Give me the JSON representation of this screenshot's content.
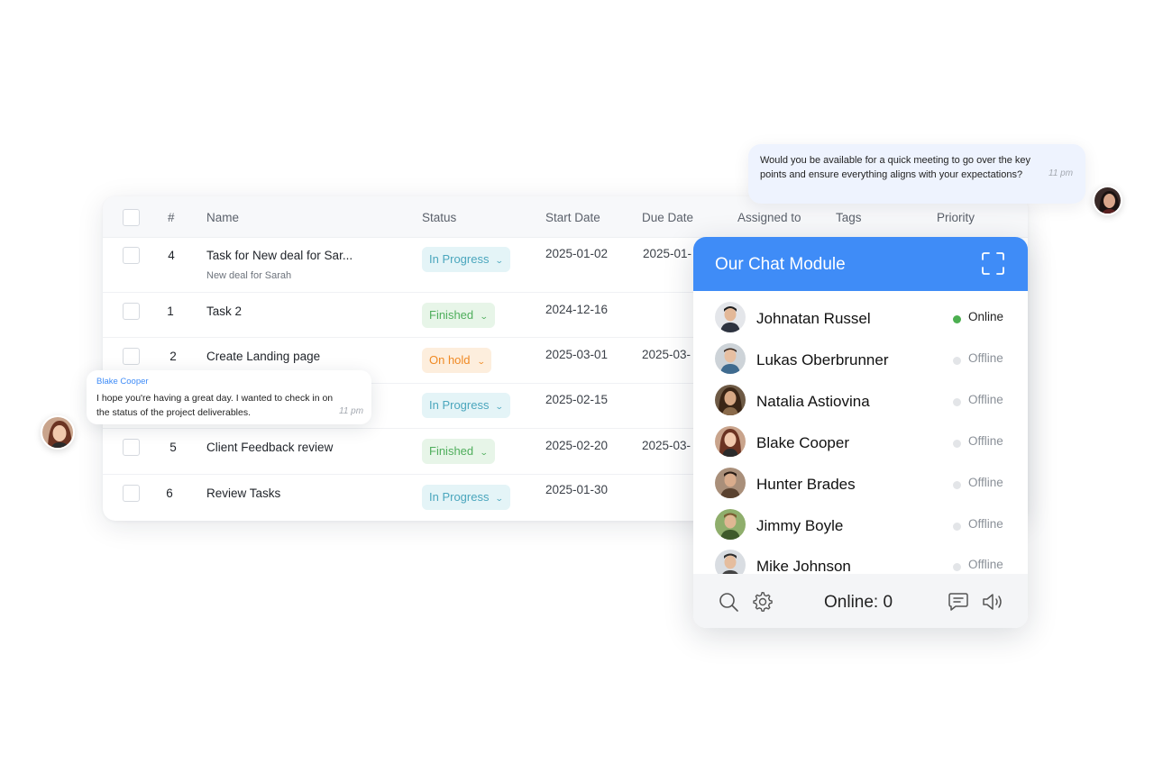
{
  "table": {
    "headers": [
      "#",
      "Name",
      "Status",
      "Start Date",
      "Due Date",
      "Assigned to",
      "Tags",
      "Priority"
    ],
    "rows": [
      {
        "num": "4",
        "name": "Task for New deal for Sar...",
        "subtitle": "New deal for Sarah",
        "status": "In Progress",
        "start": "2025-01-02",
        "due": "2025-01-"
      },
      {
        "num": "1",
        "name": "Task 2",
        "subtitle": "",
        "status": "Finished",
        "start": "2024-12-16",
        "due": ""
      },
      {
        "num": "2",
        "name": "Create Landing page",
        "subtitle": "",
        "status": "On hold",
        "start": "2025-03-01",
        "due": "2025-03-"
      },
      {
        "num": "",
        "name": "",
        "subtitle": "",
        "status": "In Progress",
        "start": "2025-02-15",
        "due": ""
      },
      {
        "num": "5",
        "name": "Client Feedback review",
        "subtitle": "",
        "status": "Finished",
        "start": "2025-02-20",
        "due": "2025-03-"
      },
      {
        "num": "6",
        "name": "Review Tasks",
        "subtitle": "",
        "status": "In Progress",
        "start": "2025-01-30",
        "due": ""
      }
    ]
  },
  "chat": {
    "title": "Our Chat Module",
    "online_label": "Online: 0",
    "contacts": [
      {
        "name": "Johnatan Russel",
        "status": "Online",
        "status_color": "#4caf50"
      },
      {
        "name": "Lukas Oberbrunner",
        "status": "Offline",
        "status_color": "#e3e5e8"
      },
      {
        "name": "Natalia Astiovina",
        "status": "Offline",
        "status_color": "#e3e5e8"
      },
      {
        "name": "Blake Cooper",
        "status": "Offline",
        "status_color": "#e3e5e8"
      },
      {
        "name": "Hunter Brades",
        "status": "Offline",
        "status_color": "#e3e5e8"
      },
      {
        "name": "Jimmy Boyle",
        "status": "Offline",
        "status_color": "#e3e5e8"
      },
      {
        "name": "Mike Johnson",
        "status": "Offline",
        "status_color": "#e3e5e8"
      }
    ],
    "accent_color": "#3f8cf7",
    "footer_icons": [
      "search-icon",
      "gear-icon",
      "message-icon",
      "speaker-icon"
    ]
  },
  "bubble_top": {
    "message": "Would you be available for a quick meeting to go over the key points and ensure everything aligns with your expectations?",
    "time": "11 pm"
  },
  "bubble_left": {
    "sender": "Blake Cooper",
    "message": "I hope you're having a great day. I wanted to check in on the status of the project deliverables.",
    "time": "11 pm"
  }
}
